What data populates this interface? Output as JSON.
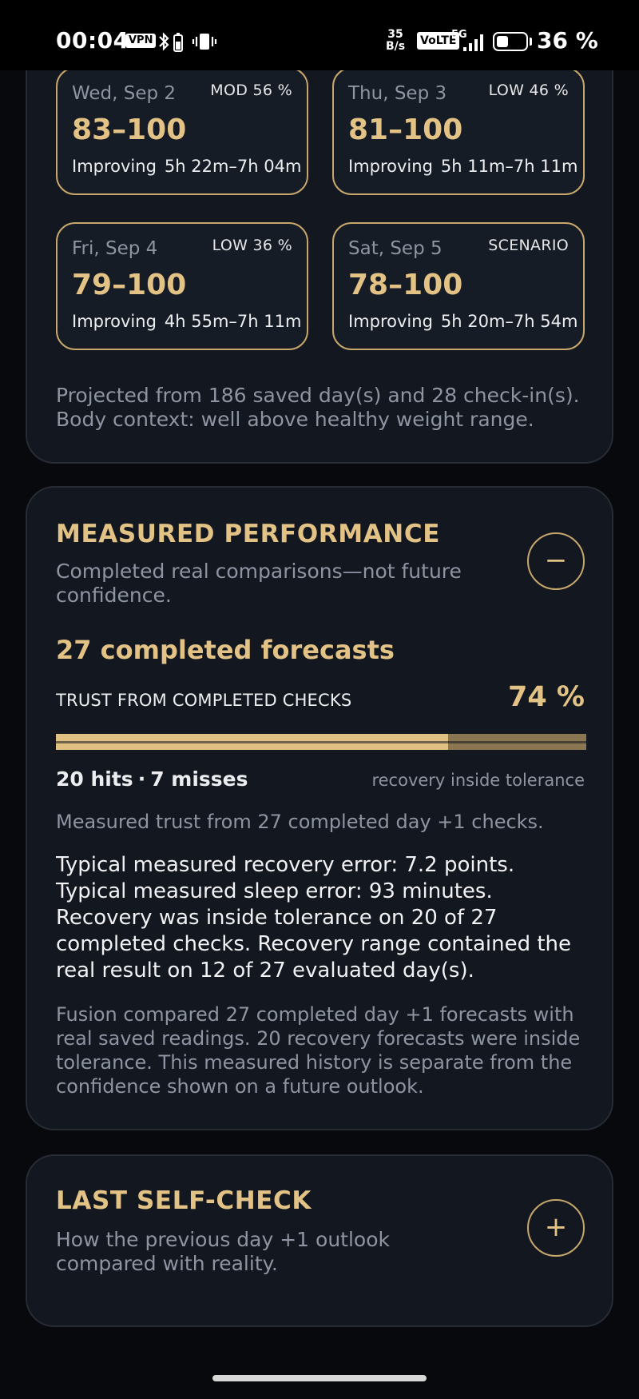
{
  "status_bar": {
    "time": "00:04",
    "vpn": "VPN",
    "speed_value": "35",
    "speed_unit": "B/s",
    "volte": "VoLTE",
    "network": "5G",
    "battery": "36 %"
  },
  "outlook": {
    "days": [
      {
        "date": "Wed, Sep 2",
        "badge": "MOD 56 %",
        "range": "83–100",
        "trend": "Improving",
        "sleep": "5h 22m–7h 04m"
      },
      {
        "date": "Thu, Sep 3",
        "badge": "LOW 46 %",
        "range": "81–100",
        "trend": "Improving",
        "sleep": "5h 11m–7h 11m"
      },
      {
        "date": "Fri, Sep 4",
        "badge": "LOW 36 %",
        "range": "79–100",
        "trend": "Improving",
        "sleep": "4h 55m–7h 11m"
      },
      {
        "date": "Sat, Sep 5",
        "badge": "SCENARIO",
        "range": "78–100",
        "trend": "Improving",
        "sleep": "5h 20m–7h 54m"
      }
    ],
    "note_line1": "Projected from 186 saved day(s) and 28 check-in(s).",
    "note_line2": "Body context: well above healthy weight range."
  },
  "measured": {
    "title": "MEASURED PERFORMANCE",
    "description": "Completed real comparisons—not future confidence.",
    "toggle": "−",
    "completed_count": "27 completed forecasts",
    "trust_label": "TRUST FROM COMPLETED CHECKS",
    "trust_pct": "74 %",
    "trust_fraction": 0.74,
    "hits": "20 hits",
    "separator": "·",
    "misses": "7 misses",
    "tolerance_note": "recovery inside tolerance",
    "measured_line": "Measured trust from 27 completed day +1 checks.",
    "typical": "Typical measured recovery error: 7.2 points. Typical measured sleep error: 93 minutes. Recovery was inside tolerance on 20 of 27 completed checks. Recovery range contained the real result on 12 of 27 evaluated day(s).",
    "typical_line1": "Typical measured recovery error: 7.2 points.",
    "typical_line2": "Typical measured sleep error: 93 minutes.",
    "typical_line3": "Recovery was inside tolerance on 20 of 27 completed checks. Recovery range contained the real result on 12 of 27 evaluated day(s).",
    "fusion": "Fusion compared 27 completed day +1 forecasts with real saved readings. 20 recovery forecasts were inside tolerance. This measured history is separate from the confidence shown on a future outlook."
  },
  "self_check": {
    "title": "LAST SELF-CHECK",
    "description": "How the previous day +1 outlook compared with reality.",
    "toggle": "+"
  },
  "colors": {
    "accent": "#e3c285",
    "card_bg": "#131820",
    "page_bg": "#07090d",
    "muted_text": "#8e94a1"
  }
}
